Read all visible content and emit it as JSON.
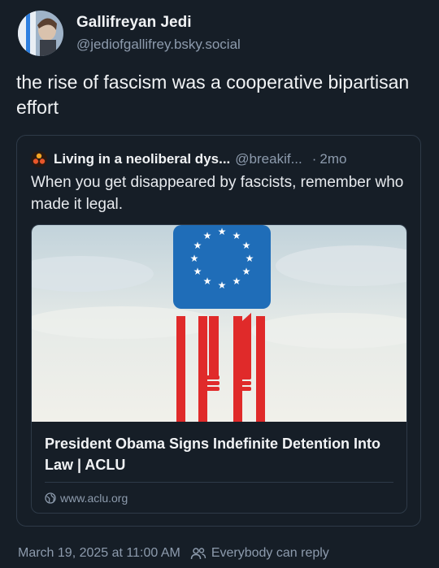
{
  "post": {
    "author": {
      "display_name": "Gallifreyan Jedi",
      "handle": "@jediofgallifrey.bsky.social",
      "avatar_icon": "avatar-portrait-icon"
    },
    "text": "the rise of fascism was a cooperative bipartisan effort"
  },
  "quote": {
    "author_name": "Living in a neoliberal dys...",
    "author_handle": "@breakif...",
    "separator": "·",
    "time": "2mo",
    "avatar_icon": "avatar-biohazard-icon",
    "text": "When you get disappeared by fascists, remember who made it legal.",
    "link": {
      "title": "President Obama Signs Indefinite Detention Into Law | ACLU",
      "domain": "www.aclu.org",
      "image_description_icon": "flag-prison-bars-image"
    }
  },
  "footer": {
    "timestamp": "March 19, 2025 at 11:00 AM",
    "reply_setting": "Everybody can reply"
  },
  "colors": {
    "background": "#161e27",
    "muted_text": "#8d9bad",
    "border": "#2e3a48",
    "flag_blue": "#1f6db8",
    "flag_red": "#e02a2a"
  }
}
